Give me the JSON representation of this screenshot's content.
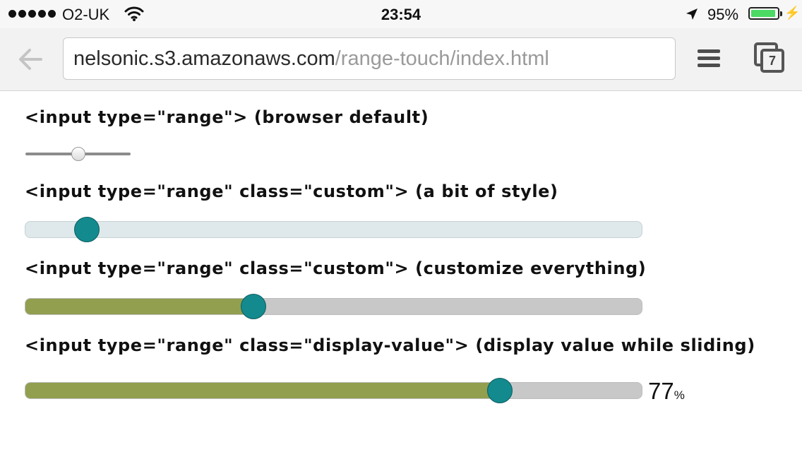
{
  "status_bar": {
    "carrier": "O2-UK",
    "time": "23:54",
    "battery_percent": "95%",
    "battery_level": 0.95,
    "icons": [
      "signal-dots-icon",
      "wifi-icon",
      "location-arrow-icon",
      "battery-icon",
      "charging-bolt-icon"
    ]
  },
  "browser": {
    "url_host": "nelsonic.s3.amazonaws.com",
    "url_path": "/range-touch/index.html",
    "tab_count": "7",
    "icons": [
      "back-arrow-icon",
      "menu-icon",
      "tabs-icon"
    ]
  },
  "sections": [
    {
      "heading": "<input type=\"range\"> (browser default)",
      "value_percent": 50
    },
    {
      "heading": "<input type=\"range\" class=\"custom\"> (a bit of style)",
      "value_percent": 10
    },
    {
      "heading": "<input type=\"range\" class=\"custom\"> (customize everything)",
      "value_percent": 37
    },
    {
      "heading": "<input type=\"range\" class=\"display-value\"> (display value while sliding)",
      "value_percent": 77
    }
  ],
  "value_display": {
    "value": "77",
    "unit": "%"
  },
  "colors": {
    "thumb": "#138a8e",
    "fill": "#919f4e",
    "track": "#c8c8c8",
    "light_track": "#dfe8ea",
    "battery": "#4cd964"
  }
}
